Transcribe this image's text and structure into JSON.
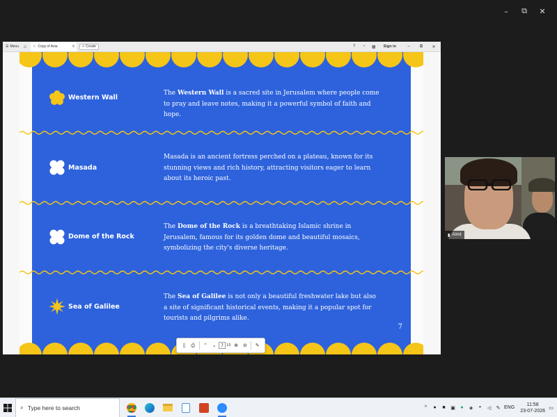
{
  "window_controls": {
    "minimize": "–",
    "restore": "⧉",
    "close": "✕"
  },
  "browser": {
    "menu_label": "Menu",
    "tab_title": "Copy of Asia",
    "tab_close": "x",
    "create_label": "Create",
    "sign_in_label": "Sign in",
    "minimize": "–",
    "restore": "⧉",
    "close": "✕"
  },
  "slide": {
    "page_number": "7",
    "rows": [
      {
        "name": "Western Wall",
        "pre": "The ",
        "bold": "Western Wall",
        "post": " is a sacred site in Jerusalem where people come to pray and leave notes, making it a powerful symbol of faith and hope."
      },
      {
        "name": "Masada",
        "pre": "",
        "bold": "",
        "post": "Masada is an ancient fortress perched on a plateau, known for its stunning views and rich history, attracting visitors eager to learn about its heroic past."
      },
      {
        "name": "Dome of the Rock",
        "pre": "The ",
        "bold": "Dome of the Rock",
        "post": " is a breathtaking Islamic shrine in Jerusalem, famous for its golden dome and beautiful mosaics, symbolizing the city's diverse heritage."
      },
      {
        "name": "Sea of Galilee",
        "pre": "The ",
        "bold": "Sea of Galilee",
        "post": " is not only a beautiful freshwater lake but also a site of significant historical events, making it a popular spot for tourists and pilgrims alike."
      }
    ]
  },
  "pdf_toolbar": {
    "current_page": "7",
    "total_pages": "10"
  },
  "webcam": {
    "participant_name": "Almit"
  },
  "taskbar": {
    "search_placeholder": "Type here to search",
    "language": "ENG",
    "time": "11:58",
    "date": "23-07-2026"
  },
  "colors": {
    "slide_blue": "#2d62dc",
    "accent_yellow": "#f5c518"
  }
}
